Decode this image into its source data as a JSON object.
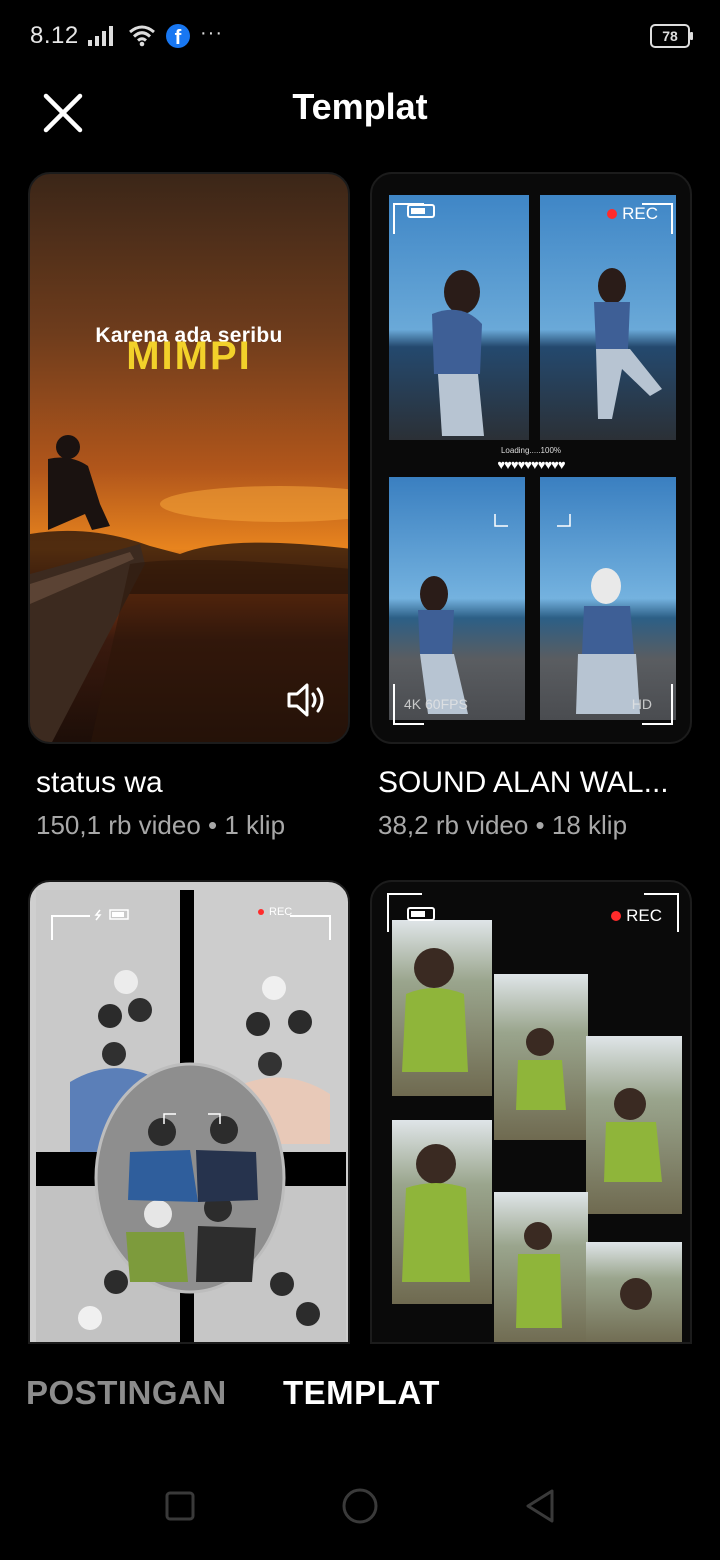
{
  "status_bar": {
    "time": "8.12",
    "more": "···",
    "battery": "78",
    "icons": [
      "signal-icon",
      "wifi-icon",
      "facebook-icon",
      "more-dots-icon",
      "battery-icon"
    ]
  },
  "header": {
    "title": "Templat",
    "close_icon": "close-icon"
  },
  "templates": [
    {
      "title": "status wa",
      "meta": "150,1 rb video • 1 klip",
      "overlay_line1": "Karena ada seribu",
      "overlay_line2": "MIMPI",
      "has_sound": true
    },
    {
      "title": "SOUND ALAN WAL...",
      "meta": "38,2 rb video • 18 klip",
      "rec": "REC",
      "loading": "Loading.....100%",
      "hearts": "♥♥♥♥♥♥♥♥♥♥",
      "corner_left": "4K 60FPS",
      "corner_right": "HD"
    },
    {
      "rec": "REC"
    },
    {
      "rec": "REC"
    }
  ],
  "tabs": [
    {
      "label": "POSTINGAN",
      "active": false
    },
    {
      "label": "TEMPLAT",
      "active": true
    }
  ],
  "nav": [
    "recents-square-icon",
    "home-circle-icon",
    "back-triangle-icon"
  ],
  "colors": {
    "background": "#000000",
    "text_primary": "#ffffff",
    "text_secondary": "#a8a8a8",
    "tab_inactive": "#8c8c8c",
    "rec_red": "#ff2b2b",
    "mimpi_yellow": "#f2d12a"
  }
}
